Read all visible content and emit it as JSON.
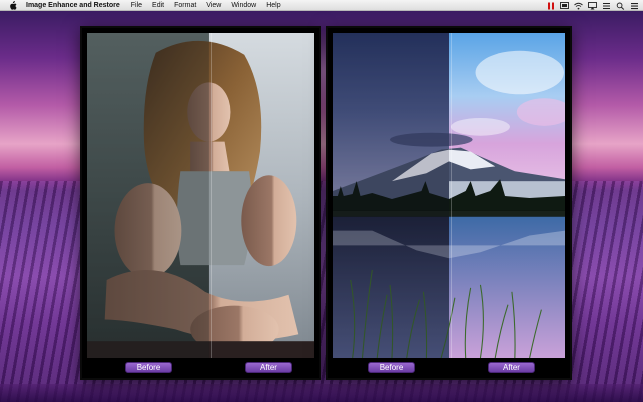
{
  "menubar": {
    "app_name": "Image Enhance and Restore",
    "items": [
      "File",
      "Edit",
      "Format",
      "View",
      "Window",
      "Help"
    ],
    "status_icons": [
      "stop-icon",
      "cast-icon",
      "wifi-icon",
      "airplay-icon",
      "list-icon",
      "search-icon",
      "menu-icon"
    ]
  },
  "windows": [
    {
      "subject": "portrait",
      "before_label": "Before",
      "after_label": "After"
    },
    {
      "subject": "landscape",
      "before_label": "Before",
      "after_label": "After"
    }
  ],
  "colors": {
    "button_top": "#9a68cf",
    "button_bottom": "#6d3ea6",
    "window_frame": "#000000",
    "menubar": "#eeeeee"
  }
}
